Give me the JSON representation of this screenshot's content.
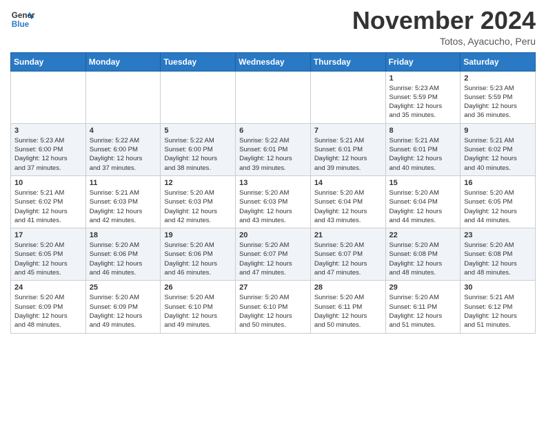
{
  "header": {
    "logo_line1": "General",
    "logo_line2": "Blue",
    "month": "November 2024",
    "location": "Totos, Ayacucho, Peru"
  },
  "weekdays": [
    "Sunday",
    "Monday",
    "Tuesday",
    "Wednesday",
    "Thursday",
    "Friday",
    "Saturday"
  ],
  "weeks": [
    [
      {
        "day": "",
        "info": ""
      },
      {
        "day": "",
        "info": ""
      },
      {
        "day": "",
        "info": ""
      },
      {
        "day": "",
        "info": ""
      },
      {
        "day": "",
        "info": ""
      },
      {
        "day": "1",
        "info": "Sunrise: 5:23 AM\nSunset: 5:59 PM\nDaylight: 12 hours\nand 35 minutes."
      },
      {
        "day": "2",
        "info": "Sunrise: 5:23 AM\nSunset: 5:59 PM\nDaylight: 12 hours\nand 36 minutes."
      }
    ],
    [
      {
        "day": "3",
        "info": "Sunrise: 5:23 AM\nSunset: 6:00 PM\nDaylight: 12 hours\nand 37 minutes."
      },
      {
        "day": "4",
        "info": "Sunrise: 5:22 AM\nSunset: 6:00 PM\nDaylight: 12 hours\nand 37 minutes."
      },
      {
        "day": "5",
        "info": "Sunrise: 5:22 AM\nSunset: 6:00 PM\nDaylight: 12 hours\nand 38 minutes."
      },
      {
        "day": "6",
        "info": "Sunrise: 5:22 AM\nSunset: 6:01 PM\nDaylight: 12 hours\nand 39 minutes."
      },
      {
        "day": "7",
        "info": "Sunrise: 5:21 AM\nSunset: 6:01 PM\nDaylight: 12 hours\nand 39 minutes."
      },
      {
        "day": "8",
        "info": "Sunrise: 5:21 AM\nSunset: 6:01 PM\nDaylight: 12 hours\nand 40 minutes."
      },
      {
        "day": "9",
        "info": "Sunrise: 5:21 AM\nSunset: 6:02 PM\nDaylight: 12 hours\nand 40 minutes."
      }
    ],
    [
      {
        "day": "10",
        "info": "Sunrise: 5:21 AM\nSunset: 6:02 PM\nDaylight: 12 hours\nand 41 minutes."
      },
      {
        "day": "11",
        "info": "Sunrise: 5:21 AM\nSunset: 6:03 PM\nDaylight: 12 hours\nand 42 minutes."
      },
      {
        "day": "12",
        "info": "Sunrise: 5:20 AM\nSunset: 6:03 PM\nDaylight: 12 hours\nand 42 minutes."
      },
      {
        "day": "13",
        "info": "Sunrise: 5:20 AM\nSunset: 6:03 PM\nDaylight: 12 hours\nand 43 minutes."
      },
      {
        "day": "14",
        "info": "Sunrise: 5:20 AM\nSunset: 6:04 PM\nDaylight: 12 hours\nand 43 minutes."
      },
      {
        "day": "15",
        "info": "Sunrise: 5:20 AM\nSunset: 6:04 PM\nDaylight: 12 hours\nand 44 minutes."
      },
      {
        "day": "16",
        "info": "Sunrise: 5:20 AM\nSunset: 6:05 PM\nDaylight: 12 hours\nand 44 minutes."
      }
    ],
    [
      {
        "day": "17",
        "info": "Sunrise: 5:20 AM\nSunset: 6:05 PM\nDaylight: 12 hours\nand 45 minutes."
      },
      {
        "day": "18",
        "info": "Sunrise: 5:20 AM\nSunset: 6:06 PM\nDaylight: 12 hours\nand 46 minutes."
      },
      {
        "day": "19",
        "info": "Sunrise: 5:20 AM\nSunset: 6:06 PM\nDaylight: 12 hours\nand 46 minutes."
      },
      {
        "day": "20",
        "info": "Sunrise: 5:20 AM\nSunset: 6:07 PM\nDaylight: 12 hours\nand 47 minutes."
      },
      {
        "day": "21",
        "info": "Sunrise: 5:20 AM\nSunset: 6:07 PM\nDaylight: 12 hours\nand 47 minutes."
      },
      {
        "day": "22",
        "info": "Sunrise: 5:20 AM\nSunset: 6:08 PM\nDaylight: 12 hours\nand 48 minutes."
      },
      {
        "day": "23",
        "info": "Sunrise: 5:20 AM\nSunset: 6:08 PM\nDaylight: 12 hours\nand 48 minutes."
      }
    ],
    [
      {
        "day": "24",
        "info": "Sunrise: 5:20 AM\nSunset: 6:09 PM\nDaylight: 12 hours\nand 48 minutes."
      },
      {
        "day": "25",
        "info": "Sunrise: 5:20 AM\nSunset: 6:09 PM\nDaylight: 12 hours\nand 49 minutes."
      },
      {
        "day": "26",
        "info": "Sunrise: 5:20 AM\nSunset: 6:10 PM\nDaylight: 12 hours\nand 49 minutes."
      },
      {
        "day": "27",
        "info": "Sunrise: 5:20 AM\nSunset: 6:10 PM\nDaylight: 12 hours\nand 50 minutes."
      },
      {
        "day": "28",
        "info": "Sunrise: 5:20 AM\nSunset: 6:11 PM\nDaylight: 12 hours\nand 50 minutes."
      },
      {
        "day": "29",
        "info": "Sunrise: 5:20 AM\nSunset: 6:11 PM\nDaylight: 12 hours\nand 51 minutes."
      },
      {
        "day": "30",
        "info": "Sunrise: 5:21 AM\nSunset: 6:12 PM\nDaylight: 12 hours\nand 51 minutes."
      }
    ]
  ]
}
